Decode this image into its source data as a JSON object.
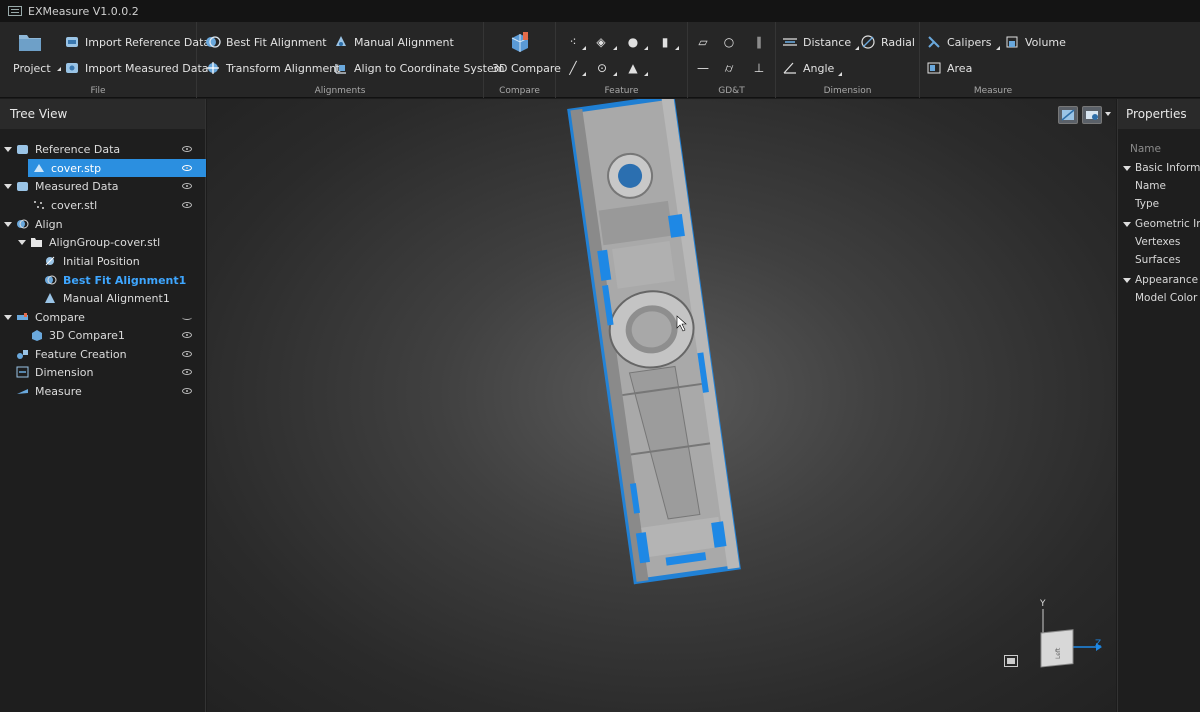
{
  "window": {
    "title": "EXMeasure V1.0.0.2"
  },
  "ribbon": {
    "file": {
      "label": "File",
      "project": "Project",
      "import_reference": "Import Reference Data",
      "import_measured": "Import Measured Data"
    },
    "alignments": {
      "label": "Alignments",
      "best_fit": "Best Fit Alignment",
      "transform": "Transform Alignment",
      "manual": "Manual Alignment",
      "coord_system": "Align to Coordinate System"
    },
    "compare": {
      "label": "Compare",
      "compare_3d": "3D Compare"
    },
    "feature": {
      "label": "Feature"
    },
    "gdt": {
      "label": "GD&T"
    },
    "dimension": {
      "label": "Dimension",
      "distance": "Distance",
      "radial": "Radial",
      "angle": "Angle"
    },
    "measure": {
      "label": "Measure",
      "calipers": "Calipers",
      "volume": "Volume",
      "area": "Area"
    }
  },
  "tree": {
    "title": "Tree View",
    "items": [
      {
        "label": "Reference Data"
      },
      {
        "label": "cover.stp"
      },
      {
        "label": "Measured Data"
      },
      {
        "label": "cover.stl"
      },
      {
        "label": "Align"
      },
      {
        "label": "AlignGroup-cover.stl"
      },
      {
        "label": "Initial Position"
      },
      {
        "label": "Best Fit Alignment1"
      },
      {
        "label": "Manual Alignment1"
      },
      {
        "label": "Compare"
      },
      {
        "label": "3D Compare1"
      },
      {
        "label": "Feature Creation"
      },
      {
        "label": "Dimension"
      },
      {
        "label": "Measure"
      }
    ]
  },
  "viewport": {
    "axis_y": "Y",
    "axis_z": "Z",
    "view_cube_face": "Left"
  },
  "properties": {
    "title": "Properties",
    "column_name": "Name",
    "basic_info": "Basic Information",
    "name": "Name",
    "type": "Type",
    "geometric_info": "Geometric Information",
    "vertexes": "Vertexes",
    "surfaces": "Surfaces",
    "appearance_info": "Appearance Information",
    "model_color": "Model Color"
  },
  "colors": {
    "accent": "#2b8fe0",
    "selection_text": "#3ea6ff",
    "overlay_blue": "#1e88e5"
  }
}
